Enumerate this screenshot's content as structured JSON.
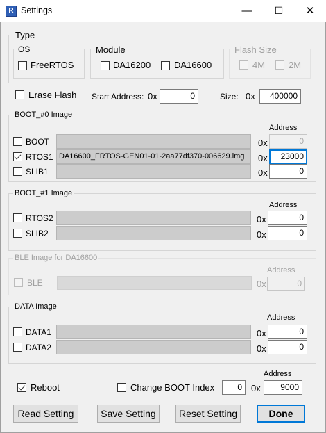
{
  "window": {
    "title": "Settings",
    "icon": "R",
    "min_glyph": "—",
    "max_glyph": "☐",
    "close_glyph": "✕"
  },
  "type": {
    "label": "Type",
    "os": {
      "label": "OS",
      "options": [
        "FreeRTOS"
      ]
    },
    "module": {
      "label": "Module",
      "options": [
        "DA16200",
        "DA16600"
      ]
    },
    "flash_size": {
      "label": "Flash Size",
      "options": [
        "4M",
        "2M"
      ]
    }
  },
  "erase_flash": {
    "label": "Erase Flash"
  },
  "start_address": {
    "label": "Start Address:",
    "prefix": "0x",
    "value": "0"
  },
  "size": {
    "label": "Size:",
    "prefix": "0x",
    "value": "400000"
  },
  "boot0": {
    "title": "BOOT_#0 Image",
    "address_header": "Address",
    "rows": [
      {
        "label": "BOOT",
        "path": "",
        "prefix": "0x",
        "address": "0",
        "checked": false
      },
      {
        "label": "RTOS1",
        "path": "DA16600_FRTOS-GEN01-01-2aa77df370-006629.img",
        "prefix": "0x",
        "address": "23000",
        "checked": true
      },
      {
        "label": "SLIB1",
        "path": "",
        "prefix": "0x",
        "address": "0",
        "checked": false
      }
    ]
  },
  "boot1": {
    "title": "BOOT_#1 Image",
    "address_header": "Address",
    "rows": [
      {
        "label": "RTOS2",
        "path": "",
        "prefix": "0x",
        "address": "0"
      },
      {
        "label": "SLIB2",
        "path": "",
        "prefix": "0x",
        "address": "0"
      }
    ]
  },
  "ble": {
    "title": "BLE Image for DA16600",
    "address_header": "Address",
    "rows": [
      {
        "label": "BLE",
        "path": "",
        "prefix": "0x",
        "address": "0"
      }
    ]
  },
  "data_image": {
    "title": "DATA Image",
    "address_header": "Address",
    "rows": [
      {
        "label": "DATA1",
        "path": "",
        "prefix": "0x",
        "address": "0"
      },
      {
        "label": "DATA2",
        "path": "",
        "prefix": "0x",
        "address": "0"
      }
    ]
  },
  "reboot": {
    "label": "Reboot",
    "checked": true
  },
  "change_boot_index": {
    "label": "Change BOOT Index",
    "index": "0",
    "prefix": "0x",
    "address_header": "Address",
    "address": "9000"
  },
  "buttons": {
    "read": "Read Setting",
    "save": "Save Setting",
    "reset": "Reset Setting",
    "done": "Done"
  },
  "colors": {
    "focus": "#0078d7",
    "window_bg": "#f0f0f0",
    "path_bg": "#cccccc",
    "disabled_text": "#a0a0a0"
  }
}
